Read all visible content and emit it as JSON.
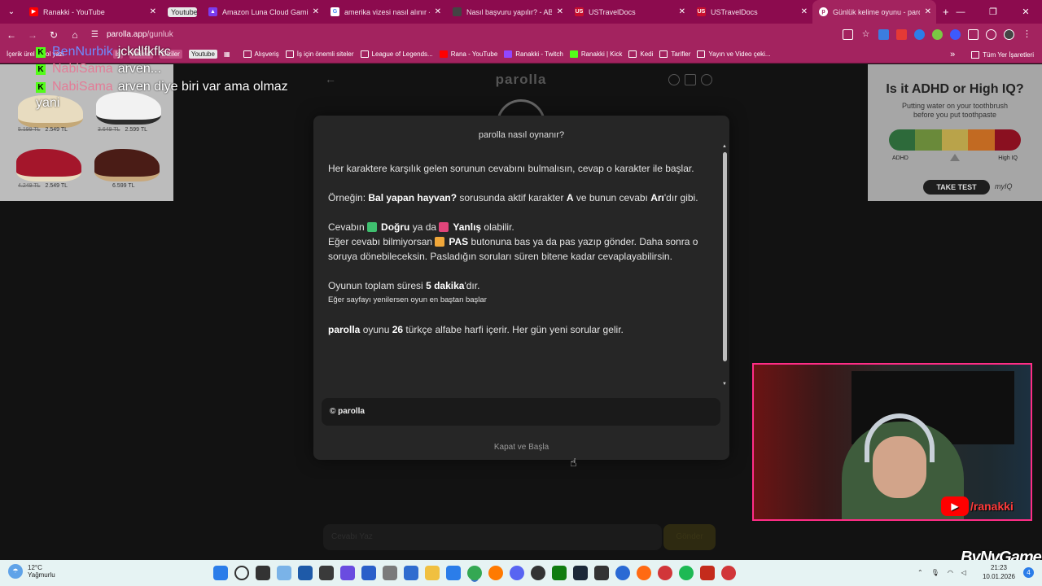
{
  "browser": {
    "tabs": [
      {
        "title": "Ranakki - YouTube",
        "fav_color": "#ff0000"
      },
      {
        "title": "Youtube",
        "fav_color": "#e7e7e7"
      },
      {
        "title": "Amazon Luna Cloud Gaming",
        "fav_color": "#7a3cf0"
      },
      {
        "title": "amerika vizesi nasıl alınır - Go",
        "fav_color": "#ffffff"
      },
      {
        "title": "Nasıl başvuru yapılır? - ABD /",
        "fav_color": "#444444"
      },
      {
        "title": "USTravelDocs",
        "fav_color": "#c8102e"
      },
      {
        "title": "USTravelDocs",
        "fav_color": "#c8102e"
      },
      {
        "title": "Günlük kelime oyunu - parolla",
        "fav_color": "#ffffff"
      }
    ],
    "new_tab": "+",
    "url_host": "parolla.app",
    "url_path": "/gunluk",
    "bookmarks": [
      {
        "label": "İçerik ürel",
        "type": "text"
      },
      {
        "label": "Sol yazi",
        "type": "text"
      },
      {
        "label": "İş",
        "type": "badge"
      },
      {
        "label": "Anime",
        "type": "badge"
      },
      {
        "label": "Diziler",
        "type": "text"
      },
      {
        "label": "Youtube",
        "type": "badge2"
      },
      {
        "label": "Alışveriş",
        "type": "folder"
      },
      {
        "label": "İş için önemli siteler",
        "type": "folder"
      },
      {
        "label": "League of Legends...",
        "type": "folder"
      },
      {
        "label": "Rana - YouTube",
        "type": "yt"
      },
      {
        "label": "Ranakki - Twitch",
        "type": "twitch"
      },
      {
        "label": "Ranakki | Kick",
        "type": "kick"
      },
      {
        "label": "Kedi",
        "type": "folder"
      },
      {
        "label": "Tarifler",
        "type": "folder"
      },
      {
        "label": "Yayın ve Video çeki...",
        "type": "folder"
      }
    ],
    "all_bookmarks": "Tüm Yer İşaretleri",
    "more_bookmarks": "»"
  },
  "left_ad": {
    "items": [
      {
        "old": "5.199 TL",
        "new": "2.549 TL"
      },
      {
        "old": "3.649 TL",
        "new": "2.599 TL"
      },
      {
        "old": "4.249 TL",
        "new": "2.549 TL"
      },
      {
        "old": "",
        "new": "6.599 TL"
      }
    ]
  },
  "right_ad": {
    "title": "Is it ADHD or High IQ?",
    "subtitle": "Putting water on your toothbrush before you put toothpaste",
    "left_label": "ADHD",
    "right_label": "High IQ",
    "button": "TAKE TEST",
    "brand": "myIQ"
  },
  "game": {
    "logo": "parolla",
    "input_placeholder": "Cevabı Yaz",
    "submit": "Gönder"
  },
  "modal": {
    "title": "parolla nasıl oynanır?",
    "p1": "Her karaktere karşılık gelen sorunun cevabını bulmalısın, cevap o karakter ile başlar.",
    "p2_pre": "Örneğin: ",
    "p2_q": "Bal yapan hayvan?",
    "p2_mid": " sorusunda aktif karakter ",
    "p2_char": "A",
    "p2_mid2": " ve bunun cevabı ",
    "p2_ans": "Arı",
    "p2_end": "'dır gibi.",
    "p3_pre": "Cevabın ",
    "p3_true": "Doğru",
    "p3_mid": " ya da ",
    "p3_false": "Yanlış",
    "p3_end": " olabilir.",
    "p4_pre": "Eğer cevabı bilmiyorsan ",
    "p4_pas": "PAS",
    "p4_end": " butonuna bas ya da pas yazıp gönder. Daha sonra o soruya dönebileceksin. Pasladığın soruları süren bitene kadar cevaplayabilirsin.",
    "p5_pre": "Oyunun toplam süresi ",
    "p5_time": "5 dakika",
    "p5_end": "'dır.",
    "p6": "Eğer sayfayı yenilersen oyun en baştan başlar",
    "p7_brand": "parolla",
    "p7_mid": " oyunu ",
    "p7_num": "26",
    "p7_end": " türkçe alfabe harfi içerir. Her gün yeni sorular gelir.",
    "footer": "© parolla",
    "close": "Kapat ve Başla",
    "colors": {
      "true": "#3fbf6f",
      "false": "#e0457a",
      "pas": "#f0a73a"
    }
  },
  "chat": [
    {
      "user": "BenNurbik",
      "msg": "jckdlfkfkc",
      "user_color": "#6e8cff"
    },
    {
      "user": "NabiSama",
      "msg": "arven...",
      "user_color": "#e37c97"
    },
    {
      "user": "NabiSama",
      "msg": "arven diye biri var ama olmaz yani",
      "user_color": "#e37c97"
    }
  ],
  "webcam": {
    "channel": "/ranakki"
  },
  "overlay": {
    "brand": "ByNvGame"
  },
  "taskbar": {
    "temp": "12°C",
    "weather": "Yağmurlu",
    "time": "21:23",
    "date": "10.01.2026",
    "notif": "4"
  }
}
